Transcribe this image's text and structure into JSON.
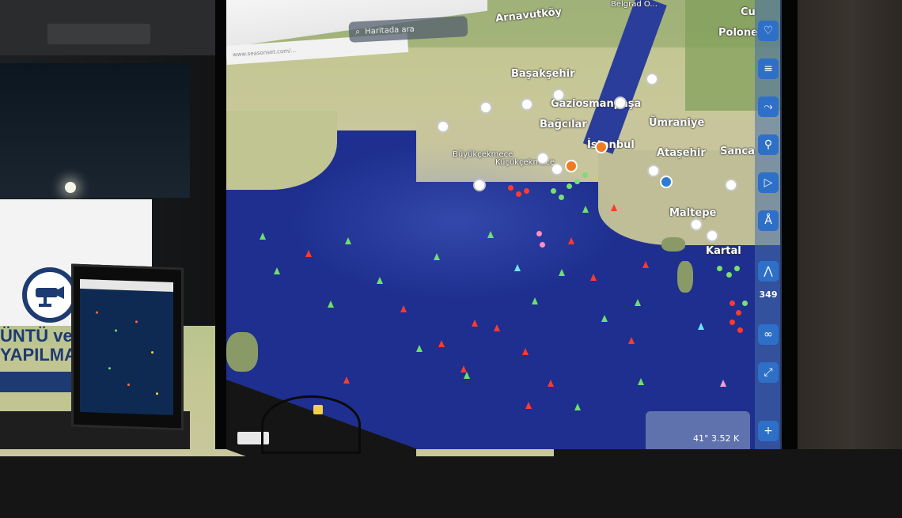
{
  "map": {
    "search_placeholder": "Haritada ara",
    "url_text": "www.seasonset.com/...",
    "places": {
      "belgrade": "Belgrad O...",
      "arnavutkoy": "Arnavutköy",
      "basaksehir": "Başakşehir",
      "gaziosmanpasa": "Gaziosmanpaşa",
      "bagcilar": "Bağcılar",
      "umraniye": "Ümraniye",
      "istanbul": "İstanbul",
      "atasehir": "Ataşehir",
      "sancaktepe": "Sanca",
      "maltepe": "Maltepe",
      "kartal": "Kartal",
      "polonezkoy": "Polonez",
      "cu": "Cu",
      "buyukcekmece": "Büyükçekmece",
      "kucukcekmece": "Küçükçekmece"
    },
    "coordinates": "41° 3.52 K"
  },
  "toolbar": {
    "heart_icon": "♡",
    "layers_icon": "≡",
    "route_icon": "⤳",
    "walk_icon": "⚲",
    "play_icon": "▷",
    "person_icon": "Å",
    "nav_icon": "⋀",
    "count_label": "349",
    "infinity_icon": "∞",
    "expand_icon": "⤢",
    "plus_icon": "+"
  },
  "banner": {
    "line1": "ÜNTÜ ve S",
    "line2": "YAPILMAK"
  },
  "colors": {
    "sea": "#1e2f8f",
    "tanker": "#ff3a2e",
    "cargo": "#6ee06b",
    "passenger": "#6fe3ff",
    "toolbar": "#2e6fc8"
  }
}
